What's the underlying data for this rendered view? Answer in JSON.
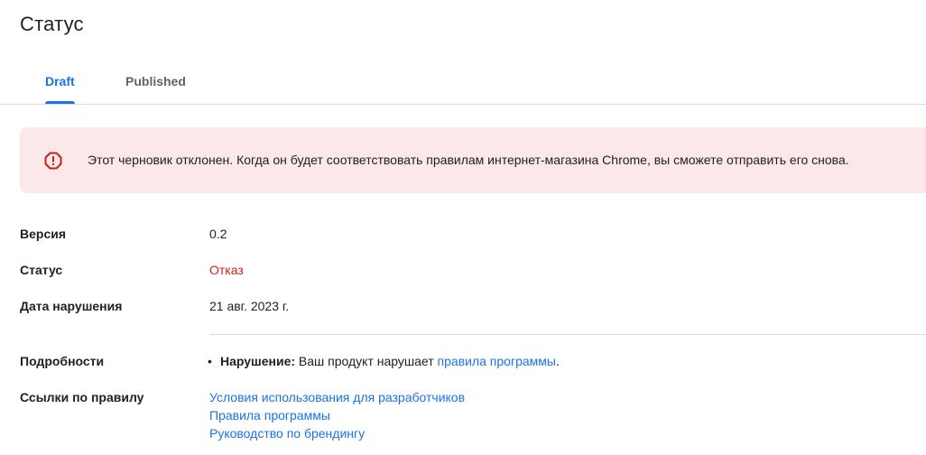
{
  "page": {
    "title": "Статус"
  },
  "tabs": [
    {
      "label": "Draft",
      "active": true
    },
    {
      "label": "Published",
      "active": false
    }
  ],
  "alert": {
    "icon": "error-icon",
    "message": "Этот черновик отклонен. Когда он будет соответствовать правилам интернет-магазина Chrome, вы сможете отправить его снова."
  },
  "details": {
    "version_label": "Версия",
    "version_value": "0.2",
    "status_label": "Статус",
    "status_value": "Отказ",
    "violation_date_label": "Дата нарушения",
    "violation_date_value": "21 авг. 2023 г.",
    "info_label": "Подробности",
    "violation_title": "Нарушение:",
    "violation_text": " Ваш продукт нарушает ",
    "violation_link": "правила программы",
    "violation_end": ".",
    "policy_links_label": "Ссылки по правилу",
    "policy_links": [
      "Условия использования для разработчиков",
      "Правила программы",
      "Руководство по брендингу"
    ]
  },
  "colors": {
    "accent": "#1a73e8",
    "error": "#c5221f",
    "alert_bg": "#fce8e9"
  }
}
